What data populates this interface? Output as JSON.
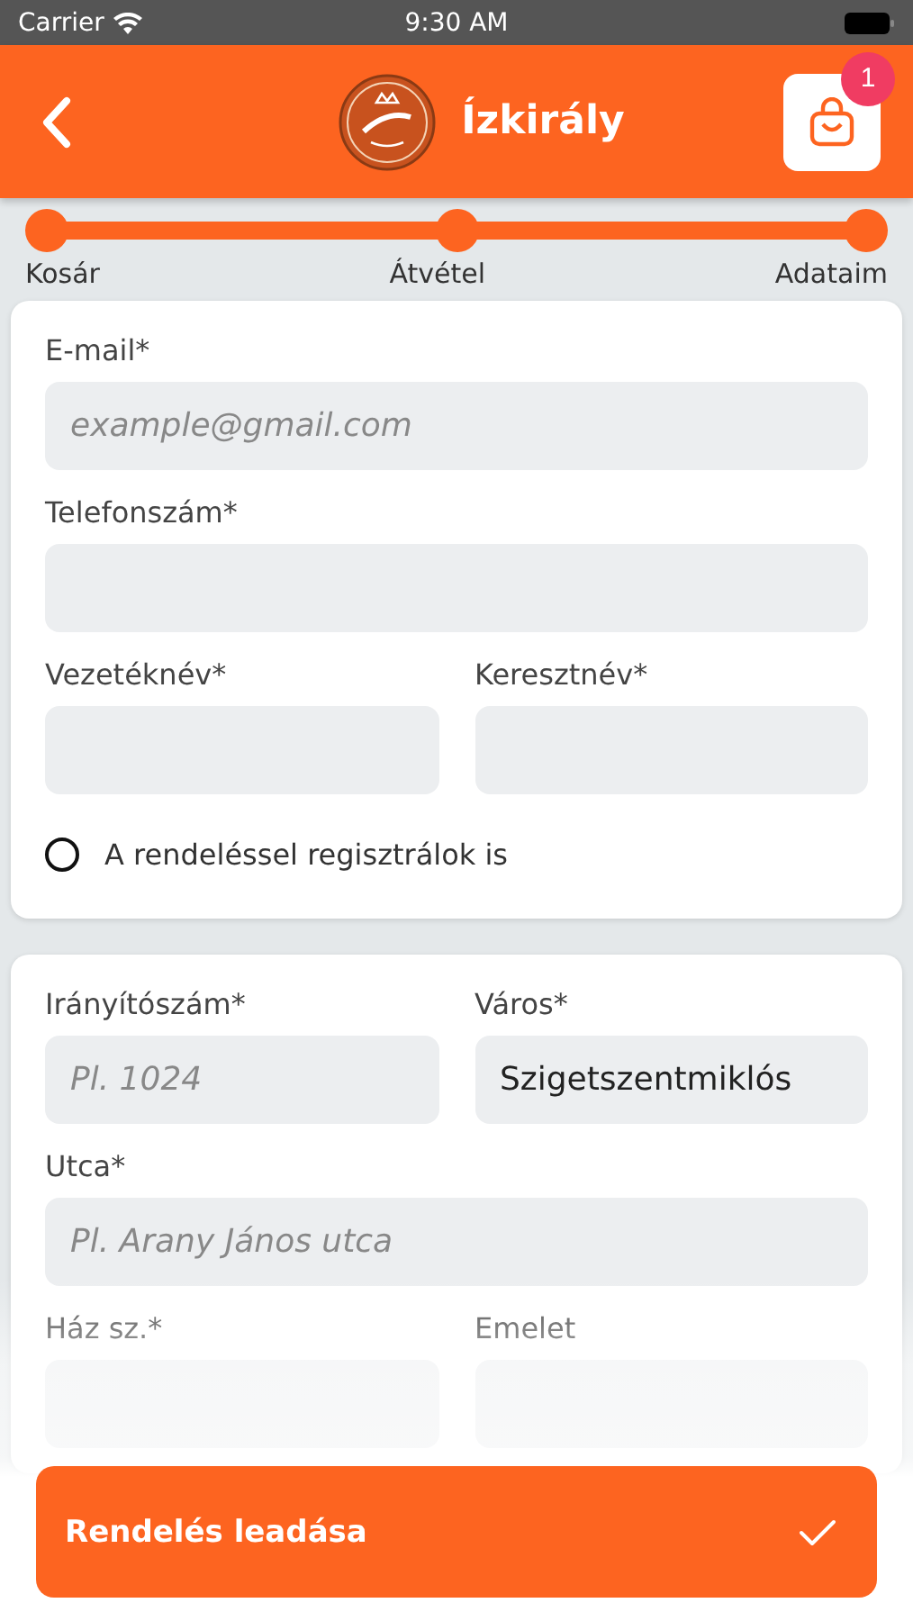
{
  "status_bar": {
    "carrier": "Carrier",
    "time": "9:30 AM"
  },
  "header": {
    "title": "Ízkirály",
    "cart_count": "1"
  },
  "steps": [
    {
      "label": "Kosár",
      "done": true
    },
    {
      "label": "Átvétel",
      "done": true
    },
    {
      "label": "Adataim",
      "done": true
    }
  ],
  "sections": [
    {
      "rows": [
        [
          {
            "label": "E-mail*",
            "placeholder": "example@gmail.com"
          }
        ],
        [
          {
            "label": "Telefonszám*"
          }
        ],
        [
          {
            "label": "Vezetéknév*"
          },
          {
            "label": "Keresztnév*"
          }
        ]
      ],
      "option": {
        "label": "A rendeléssel regisztrálok is",
        "checked": false
      }
    },
    {
      "rows": [
        [
          {
            "label": "Irányítószám*",
            "placeholder": "Pl. 1024"
          },
          {
            "label": "Város*",
            "value": "Szigetszentmiklós"
          }
        ],
        [
          {
            "label": "Utca*",
            "placeholder": "Pl. Arany János utca"
          }
        ],
        [
          {
            "label": "Ház sz.*"
          },
          {
            "label": "Emelet"
          }
        ]
      ]
    }
  ],
  "submit": {
    "label": "Rendelés leadása"
  }
}
